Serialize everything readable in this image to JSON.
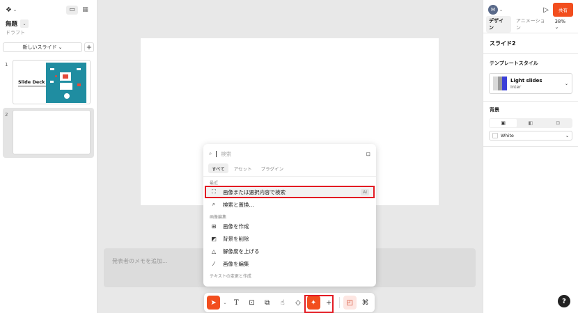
{
  "left_panel": {
    "file_title": "無題",
    "file_subtitle": "ドラフト",
    "new_slide_label": "新しいスライド ⌄",
    "slides": [
      {
        "number": "1",
        "title": "Slide Deck Title"
      },
      {
        "number": "2"
      }
    ]
  },
  "notes_placeholder": "発表者のメモを追加...",
  "right_panel": {
    "avatar_initial": "M",
    "share_label": "共有",
    "tabs": [
      "デザイン",
      "アニメーション"
    ],
    "zoom": "38%",
    "slide_name": "スライド2",
    "template_style_label": "テンプレートスタイル",
    "template": {
      "name": "Light slides",
      "font": "Inter"
    },
    "background_label": "背景",
    "background_color_name": "White",
    "help_label": "?"
  },
  "popup": {
    "search_placeholder": "検索",
    "tabs": [
      "すべて",
      "アセット",
      "プラグイン"
    ],
    "group_recent": "最近",
    "recent_items": [
      {
        "label": "画像または選択内容で検索",
        "badge": "AI",
        "icon": "image-search-icon"
      },
      {
        "label": "検索と置換...",
        "icon": "search-icon"
      }
    ],
    "group_image_edit": "画像編集",
    "image_items": [
      {
        "label": "画像を作成",
        "icon": "image-add-icon"
      },
      {
        "label": "背景を削除",
        "icon": "image-remove-bg-icon"
      },
      {
        "label": "解像度を上げる",
        "icon": "upscale-icon"
      },
      {
        "label": "画像を編集",
        "icon": "magic-edit-icon"
      }
    ],
    "group_text": "テキストの変更と作成"
  },
  "colors": {
    "accent": "#f24e1e",
    "highlight": "#e31b23",
    "slide_teal": "#1f8da1"
  }
}
